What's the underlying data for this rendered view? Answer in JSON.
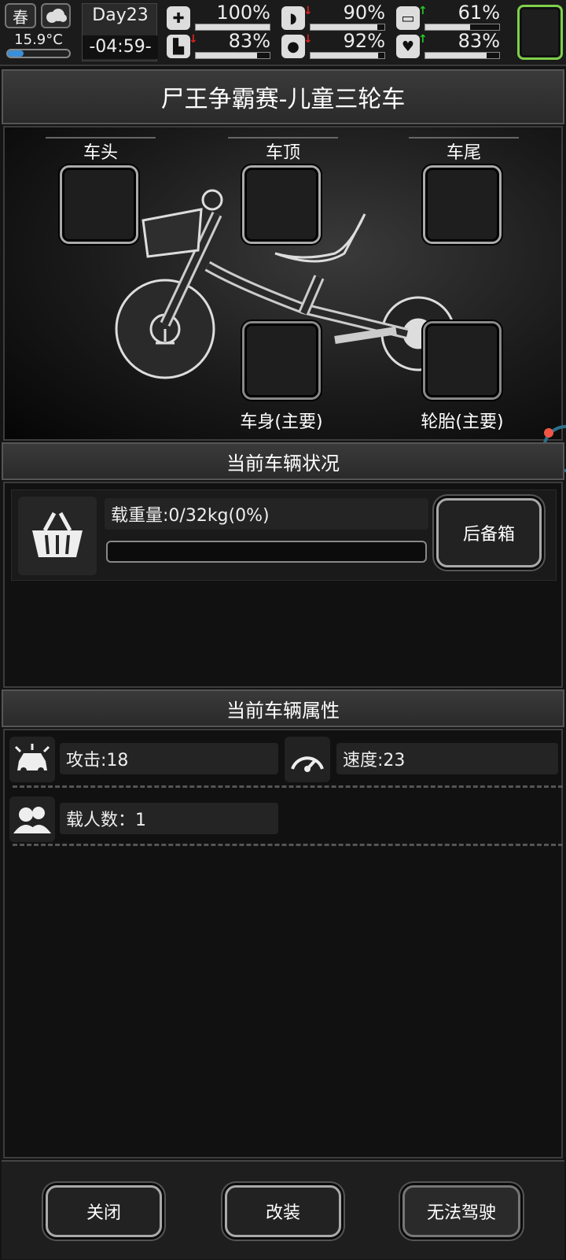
{
  "hud": {
    "season": "春",
    "temperature": "15.9°C",
    "day": "Day23",
    "time": "-04:59-",
    "stats": [
      {
        "name": "health",
        "value": "100%",
        "level": 1.0,
        "trend": "none"
      },
      {
        "name": "hunger",
        "value": "90%",
        "level": 0.9,
        "trend": "down"
      },
      {
        "name": "energy",
        "value": "61%",
        "level": 0.61,
        "trend": "up"
      },
      {
        "name": "stamina",
        "value": "83%",
        "level": 0.83,
        "trend": "down"
      },
      {
        "name": "thirst",
        "value": "92%",
        "level": 0.92,
        "trend": "down"
      },
      {
        "name": "mood",
        "value": "83%",
        "level": 0.83,
        "trend": "up"
      }
    ],
    "colors": {
      "up": "#22cc22",
      "down": "#e02020",
      "accent": "#7fd04a"
    }
  },
  "title": "尸王争霸赛-儿童三轮车",
  "slots": {
    "head": "车头",
    "top": "车顶",
    "tail": "车尾",
    "body": "车身(主要)",
    "tire": "轮胎(主要)"
  },
  "status": {
    "header": "当前车辆状况",
    "load_label": "载重量:0/32kg(0%)",
    "load_fraction": 0,
    "trunk_button": "后备箱"
  },
  "attributes": {
    "header": "当前车辆属性",
    "attack": "攻击:18",
    "speed": "速度:23",
    "passengers": "载人数：1"
  },
  "footer": {
    "close": "关闭",
    "modify": "改装",
    "drive": "无法驾驶"
  }
}
